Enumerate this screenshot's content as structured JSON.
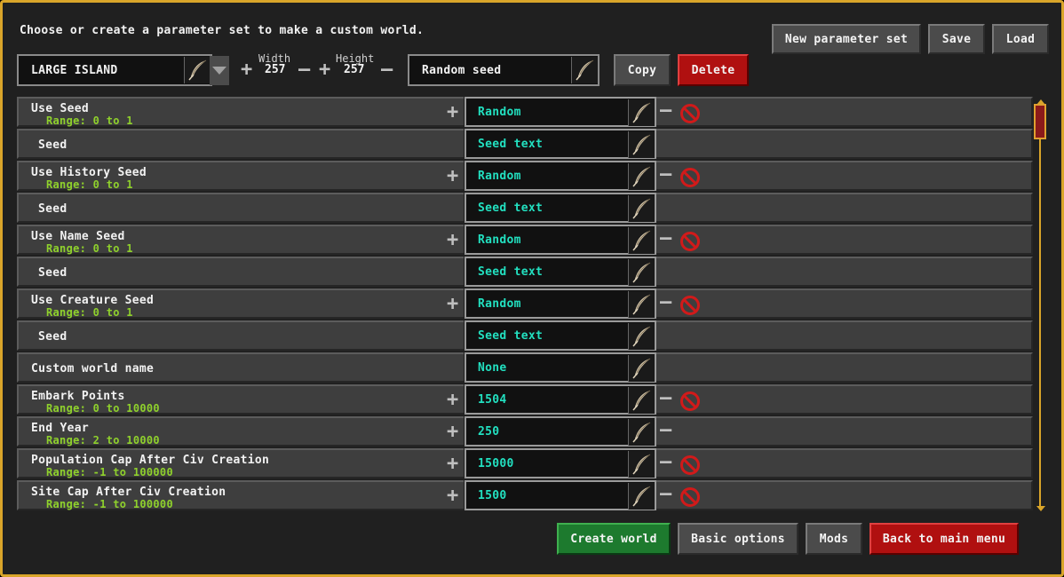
{
  "intro": "Choose or create a parameter set to make a custom world.",
  "top_buttons": {
    "new_set": "New parameter set",
    "save": "Save",
    "load": "Load"
  },
  "param_set": {
    "name": "LARGE ISLAND"
  },
  "dimensions": {
    "width_label": "Width",
    "width_value": "257",
    "height_label": "Height",
    "height_value": "257"
  },
  "seed": {
    "value": "Random seed"
  },
  "actions": {
    "copy": "Copy",
    "delete": "Delete"
  },
  "rows": [
    {
      "name": "Use Seed",
      "range": "Range: 0 to 1",
      "value": "Random",
      "has_plus": true,
      "has_minus": true,
      "has_disable": true
    },
    {
      "name": "Seed",
      "range": "",
      "value": "Seed text",
      "sub": true
    },
    {
      "name": "Use History Seed",
      "range": "Range: 0 to 1",
      "value": "Random",
      "has_plus": true,
      "has_minus": true,
      "has_disable": true
    },
    {
      "name": "Seed",
      "range": "",
      "value": "Seed text",
      "sub": true
    },
    {
      "name": "Use Name Seed",
      "range": "Range: 0 to 1",
      "value": "Random",
      "has_plus": true,
      "has_minus": true,
      "has_disable": true
    },
    {
      "name": "Seed",
      "range": "",
      "value": "Seed text",
      "sub": true
    },
    {
      "name": "Use Creature Seed",
      "range": "Range: 0 to 1",
      "value": "Random",
      "has_plus": true,
      "has_minus": true,
      "has_disable": true
    },
    {
      "name": "Seed",
      "range": "",
      "value": "Seed text",
      "sub": true
    },
    {
      "name": "Custom world name",
      "range": "",
      "value": "None"
    },
    {
      "name": "Embark Points",
      "range": "Range: 0 to 10000",
      "value": "1504",
      "has_plus": true,
      "has_minus": true,
      "has_disable": true
    },
    {
      "name": "End Year",
      "range": "Range: 2 to 10000",
      "value": "250",
      "has_plus": true,
      "has_minus": true,
      "has_disable": false
    },
    {
      "name": "Population Cap After Civ Creation",
      "range": "Range: -1 to 100000",
      "value": "15000",
      "has_plus": true,
      "has_minus": true,
      "has_disable": true
    },
    {
      "name": "Site Cap After Civ Creation",
      "range": "Range: -1 to 100000",
      "value": "1500",
      "has_plus": true,
      "has_minus": true,
      "has_disable": true
    }
  ],
  "bottom_buttons": {
    "create": "Create world",
    "basic": "Basic options",
    "mods": "Mods",
    "back": "Back to main menu"
  },
  "colors": {
    "accent_border": "#d9a52a",
    "value_text": "#22e0c0",
    "range_text": "#8fd12c",
    "delete_red": "#b01010",
    "create_green": "#1d7a2e"
  },
  "icons": {
    "edit": "quill-icon",
    "disable": "prohibited-icon",
    "increase": "plus-icon",
    "decrease": "minus-icon"
  }
}
